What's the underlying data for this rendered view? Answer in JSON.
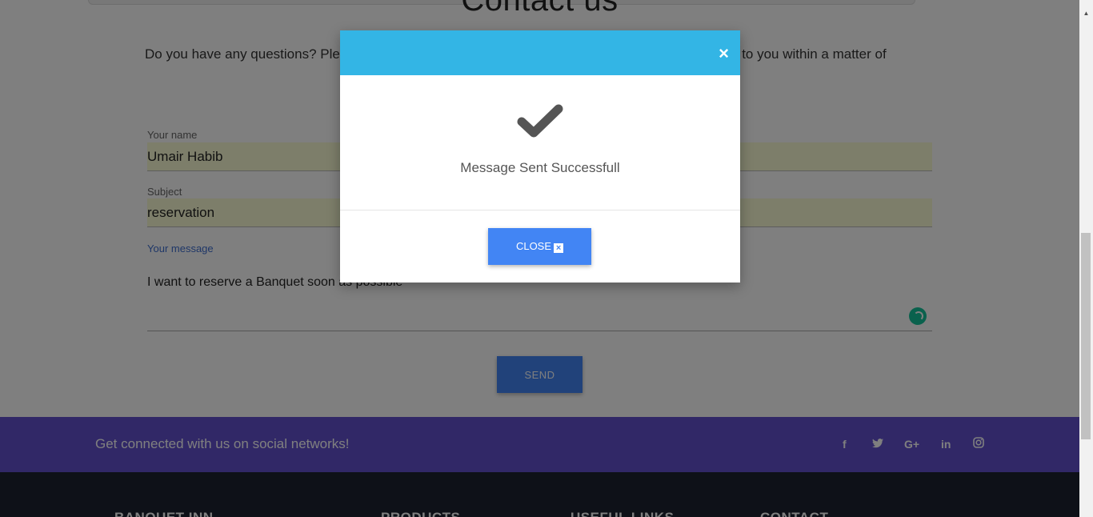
{
  "page": {
    "title": "Contact us",
    "intro": "Do you have any questions? Please do not hesitate to contact us directly. Our team will come back to you within a matter of"
  },
  "form": {
    "name_label": "Your name",
    "name_value": "Umair Habib",
    "subject_label": "Subject",
    "subject_value": "reservation",
    "message_label": "Your message",
    "message_value": "I want to reserve a Banquet soon as possible",
    "send_label": "SEND"
  },
  "social": {
    "text": "Get connected with us on social networks!",
    "icons": [
      "f",
      "t",
      "G+",
      "in",
      "ig"
    ]
  },
  "footer": {
    "columns": [
      "BANQUET INN",
      "PRODUCTS",
      "USEFUL LINKS",
      "CONTACT"
    ]
  },
  "modal": {
    "close_x": "×",
    "message": "Message Sent Successfull",
    "close_label": "CLOSE"
  },
  "colors": {
    "accent": "#33b5e5",
    "button": "#4285f4",
    "social_bar": "#6351ce",
    "footer": "#1c2331",
    "autofill": "#fafdd4"
  }
}
